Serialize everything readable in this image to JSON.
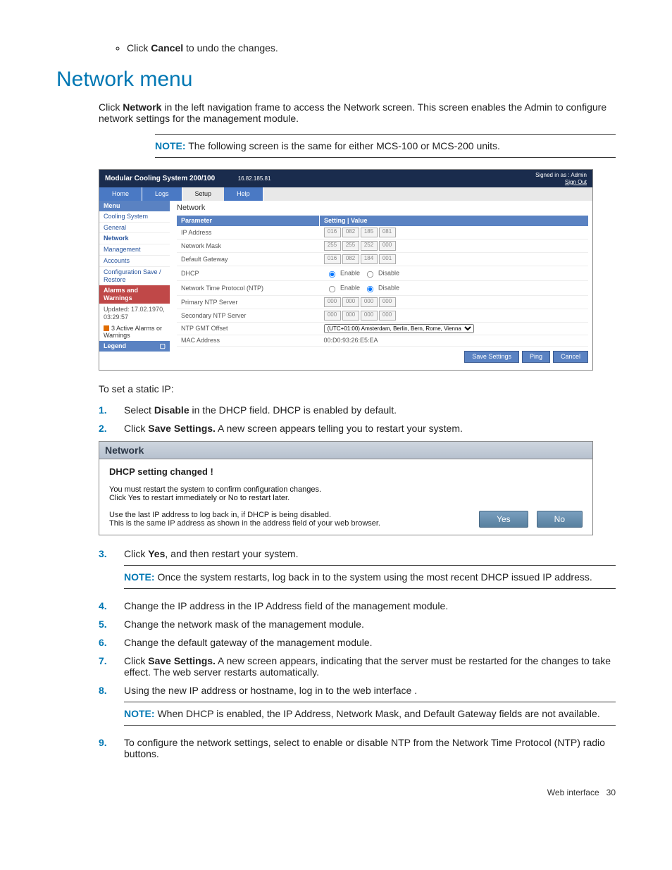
{
  "intro_bullet_prefix": "Click ",
  "intro_bullet_bold": "Cancel",
  "intro_bullet_suffix": " to undo the changes.",
  "heading": "Network menu",
  "intro_para_a": "Click ",
  "intro_para_bold": "Network",
  "intro_para_b": " in the left navigation frame to access the Network screen. This screen enables the Admin to configure network settings for the management module.",
  "note1_label": "NOTE:",
  "note1_text": "  The following screen is the same for either MCS-100 or MCS-200 units.",
  "shot1": {
    "system_title": "Modular Cooling System 200/100",
    "ip": "16.82.185.81",
    "signed_in": "Signed in as : Admin",
    "sign_out": "Sign Out",
    "menubar": [
      "Home",
      "Logs",
      "Setup",
      "Help"
    ],
    "menu_header": "Menu",
    "menu_items": [
      "Cooling System",
      "General",
      "Network",
      "Management",
      "Accounts",
      "Configuration Save / Restore"
    ],
    "active_menu": "Network",
    "alarm_header": "Alarms and Warnings",
    "updated": "Updated: 17.02.1970, 03:29:57",
    "alert": "3 Active Alarms or Warnings",
    "legend_header": "Legend",
    "main_title": "Network",
    "table_head_param": "Parameter",
    "table_head_set": "Setting",
    "table_head_val": "Value",
    "rows": [
      {
        "p": "IP Address",
        "v": [
          "016",
          "082",
          "185",
          "081"
        ],
        "type": "ip"
      },
      {
        "p": "Network Mask",
        "v": [
          "255",
          "255",
          "252",
          "000"
        ],
        "type": "ip"
      },
      {
        "p": "Default Gateway",
        "v": [
          "016",
          "082",
          "184",
          "001"
        ],
        "type": "ip"
      },
      {
        "p": "DHCP",
        "type": "radio",
        "checked": "Enable",
        "a": "Enable",
        "b": "Disable"
      },
      {
        "p": "Network Time Protocol (NTP)",
        "type": "radio",
        "checked": "Disable",
        "a": "Enable",
        "b": "Disable"
      },
      {
        "p": "Primary NTP Server",
        "v": [
          "000",
          "000",
          "000",
          "000"
        ],
        "type": "ip"
      },
      {
        "p": "Secondary NTP Server",
        "v": [
          "000",
          "000",
          "000",
          "000"
        ],
        "type": "ip"
      },
      {
        "p": "NTP GMT Offset",
        "type": "select",
        "sel": "(UTC+01:00) Amsterdam, Berlin, Bern, Rome, Vienna"
      },
      {
        "p": "MAC Address",
        "type": "text",
        "txt": "00:D0:93:26:E5:EA"
      }
    ],
    "buttons": [
      "Save Settings",
      "Ping",
      "Cancel"
    ]
  },
  "staticip_intro": "To set a static IP:",
  "step1_a": "Select ",
  "step1_b": "Disable",
  "step1_c": " in the DHCP field. DHCP is enabled by default.",
  "step2_a": "Click ",
  "step2_b": "Save Settings.",
  "step2_c": " A new screen appears telling you to restart your system.",
  "shot2": {
    "bar": "Network",
    "sub": "DHCP setting changed !",
    "p1a": "You must restart the system to confirm configuration changes.",
    "p1b": "Click Yes to restart immediately or No to restart later.",
    "p2a": "Use the last IP address to log back in, if DHCP is being disabled.",
    "p2b": "This is the same IP address as shown in the address field of your web browser.",
    "yes": "Yes",
    "no": "No"
  },
  "step3_a": "Click ",
  "step3_b": "Yes",
  "step3_c": ", and then restart your system.",
  "note2_label": "NOTE:",
  "note2_text": " Once the system restarts, log back in to the system using the most recent DHCP issued IP address.",
  "step4": "Change the IP address in the IP Address field of the management module.",
  "step5": "Change the network mask of the management module.",
  "step6": "Change the default gateway of the management module.",
  "step7_a": "Click ",
  "step7_b": "Save Settings.",
  "step7_c": " A new screen appears, indicating that the server must be restarted for the changes to take effect. The web server restarts automatically.",
  "step8": "Using the new IP address or hostname, log in to the web interface .",
  "note3_label": "NOTE:",
  "note3_text": "  When DHCP is enabled, the IP Address, Network Mask, and Default Gateway fields are not available.",
  "step9": "To configure the network settings, select to enable or disable NTP from the Network Time Protocol (NTP) radio buttons.",
  "footer_a": "Web interface",
  "footer_b": "30"
}
